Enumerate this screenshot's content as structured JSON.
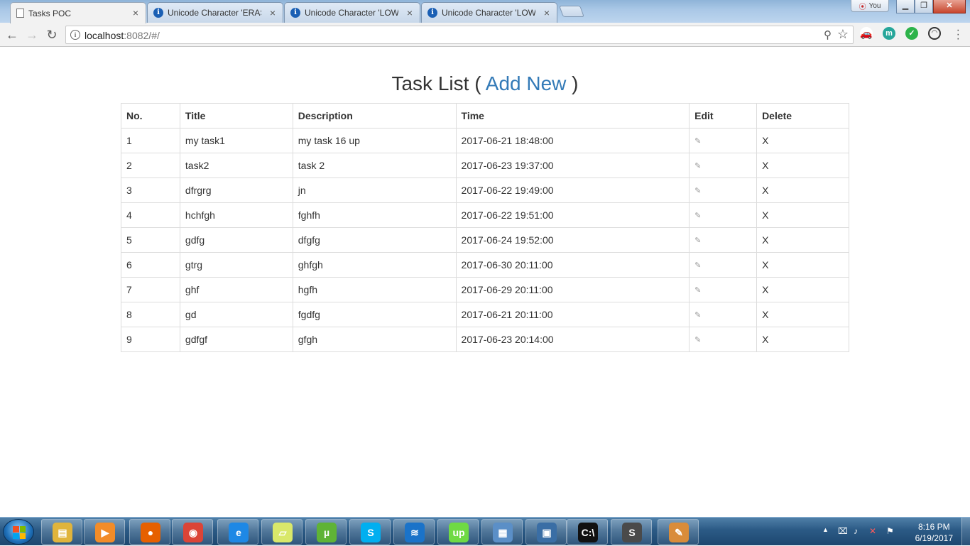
{
  "browser": {
    "tabs": [
      {
        "title": "Tasks POC",
        "icon": "document-icon"
      },
      {
        "title": "Unicode Character 'ERAS",
        "icon": "info-icon"
      },
      {
        "title": "Unicode Character 'LOW",
        "icon": "info-icon"
      },
      {
        "title": "Unicode Character 'LOW",
        "icon": "info-icon"
      }
    ],
    "tab_close": "×",
    "user_badge": "You",
    "window_buttons": {
      "minimize": "▁",
      "maximize": "❐",
      "close": "✕"
    },
    "nav": {
      "back": "←",
      "forward": "→",
      "reload": "↻"
    },
    "url_host": "localhost",
    "url_rest": ":8082/#/",
    "zoom_glyph": "⚲",
    "star_glyph": "☆",
    "extensions": [
      "car-icon",
      "m-icon",
      "check-icon",
      "gauge-icon"
    ]
  },
  "page": {
    "heading": "Task List",
    "open_paren": " ( ",
    "add_new": "Add New",
    "close_paren": " )",
    "columns": [
      "No.",
      "Title",
      "Description",
      "Time",
      "Edit",
      "Delete"
    ],
    "edit_glyph": "✎",
    "delete_label": "X",
    "rows": [
      {
        "no": "1",
        "title": "my task1",
        "description": "my task 16 up",
        "time": "2017-06-21 18:48:00"
      },
      {
        "no": "2",
        "title": "task2",
        "description": "task 2",
        "time": "2017-06-23 19:37:00"
      },
      {
        "no": "3",
        "title": "dfrgrg",
        "description": "jn",
        "time": "2017-06-22 19:49:00"
      },
      {
        "no": "4",
        "title": "hchfgh",
        "description": "fghfh",
        "time": "2017-06-22 19:51:00"
      },
      {
        "no": "5",
        "title": "gdfg",
        "description": "dfgfg",
        "time": "2017-06-24 19:52:00"
      },
      {
        "no": "6",
        "title": "gtrg",
        "description": "ghfgh",
        "time": "2017-06-30 20:11:00"
      },
      {
        "no": "7",
        "title": "ghf",
        "description": "hgfh",
        "time": "2017-06-29 20:11:00"
      },
      {
        "no": "8",
        "title": "gd",
        "description": "fgdfg",
        "time": "2017-06-21 20:11:00"
      },
      {
        "no": "9",
        "title": "gdfgf",
        "description": "gfgh",
        "time": "2017-06-23 20:14:00"
      }
    ]
  },
  "taskbar": {
    "apps": [
      {
        "name": "explorer-icon",
        "glyph": "▤",
        "color": "#e0b43c"
      },
      {
        "name": "media-player-icon",
        "glyph": "▶",
        "color": "#f28c28"
      },
      {
        "name": "firefox-icon",
        "glyph": "●",
        "color": "#e66000"
      },
      {
        "name": "chrome-icon",
        "glyph": "◉",
        "color": "#db4437"
      },
      {
        "name": "internet-explorer-icon",
        "glyph": "e",
        "color": "#1e88e5"
      },
      {
        "name": "sticky-notes-icon",
        "glyph": "▱",
        "color": "#d9e86a"
      },
      {
        "name": "utorrent-icon",
        "glyph": "µ",
        "color": "#5fb336"
      },
      {
        "name": "skype-icon",
        "glyph": "S",
        "color": "#00aff0"
      },
      {
        "name": "wifi-icon",
        "glyph": "≋",
        "color": "#1a73c9"
      },
      {
        "name": "upwork-icon",
        "glyph": "up",
        "color": "#6fda44"
      },
      {
        "name": "control-panel-icon",
        "glyph": "▦",
        "color": "#5b8fc7"
      },
      {
        "name": "remote-desktop-icon",
        "glyph": "▣",
        "color": "#3a6ea5"
      },
      {
        "name": "cmd-icon",
        "glyph": "C:\\",
        "color": "#111111"
      },
      {
        "name": "sublime-text-icon",
        "glyph": "S",
        "color": "#4a4a4a"
      },
      {
        "name": "paint-icon",
        "glyph": "✎",
        "color": "#d98c3a"
      }
    ],
    "tray_arrow": "▲",
    "clock_time": "8:16 PM",
    "clock_date": "6/19/2017"
  }
}
